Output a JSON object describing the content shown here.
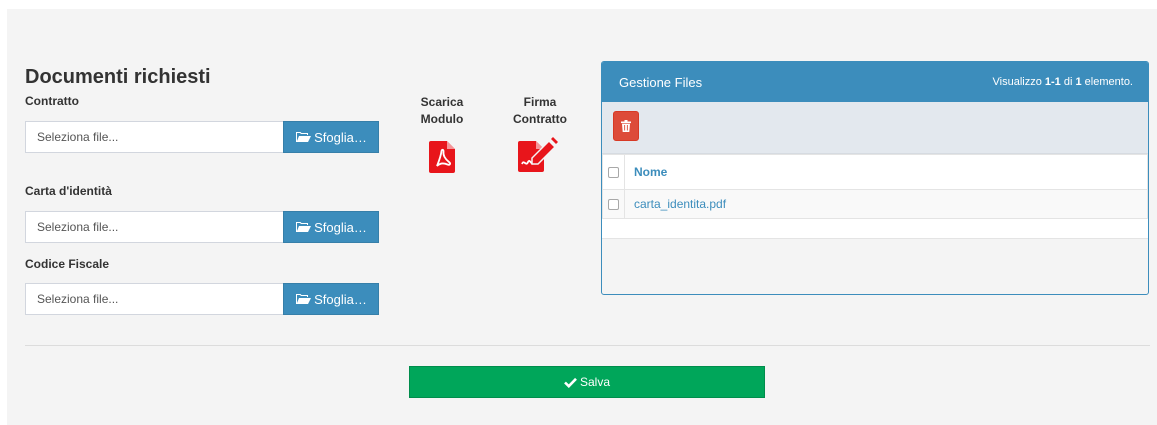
{
  "form": {
    "title": "Documenti richiesti",
    "fields": [
      {
        "label": "Contratto",
        "placeholder": "Seleziona file...",
        "button": "Sfoglia…"
      },
      {
        "label": "Carta d'identità",
        "placeholder": "Seleziona file...",
        "button": "Sfoglia…"
      },
      {
        "label": "Codice Fiscale",
        "placeholder": "Seleziona file...",
        "button": "Sfoglia…"
      }
    ]
  },
  "downloads": {
    "scarica": {
      "line1": "Scarica",
      "line2": "Modulo",
      "icon": "file-pdf-icon"
    },
    "firma": {
      "line1": "Firma",
      "line2": "Contratto",
      "icon": "signature-icon"
    }
  },
  "files_panel": {
    "title": "Gestione Files",
    "summary_prefix": "Visualizzo ",
    "summary_range": "1-1",
    "summary_mid": " di ",
    "summary_total": "1",
    "summary_suffix": " elemento.",
    "column_name": "Nome",
    "rows": [
      {
        "name": "carta_identita.pdf"
      }
    ]
  },
  "actions": {
    "save_label": "Salva"
  },
  "colors": {
    "primary": "#3c8dbc",
    "danger": "#dd4b39",
    "success": "#00a65a",
    "pdf_red": "#e8151b"
  }
}
